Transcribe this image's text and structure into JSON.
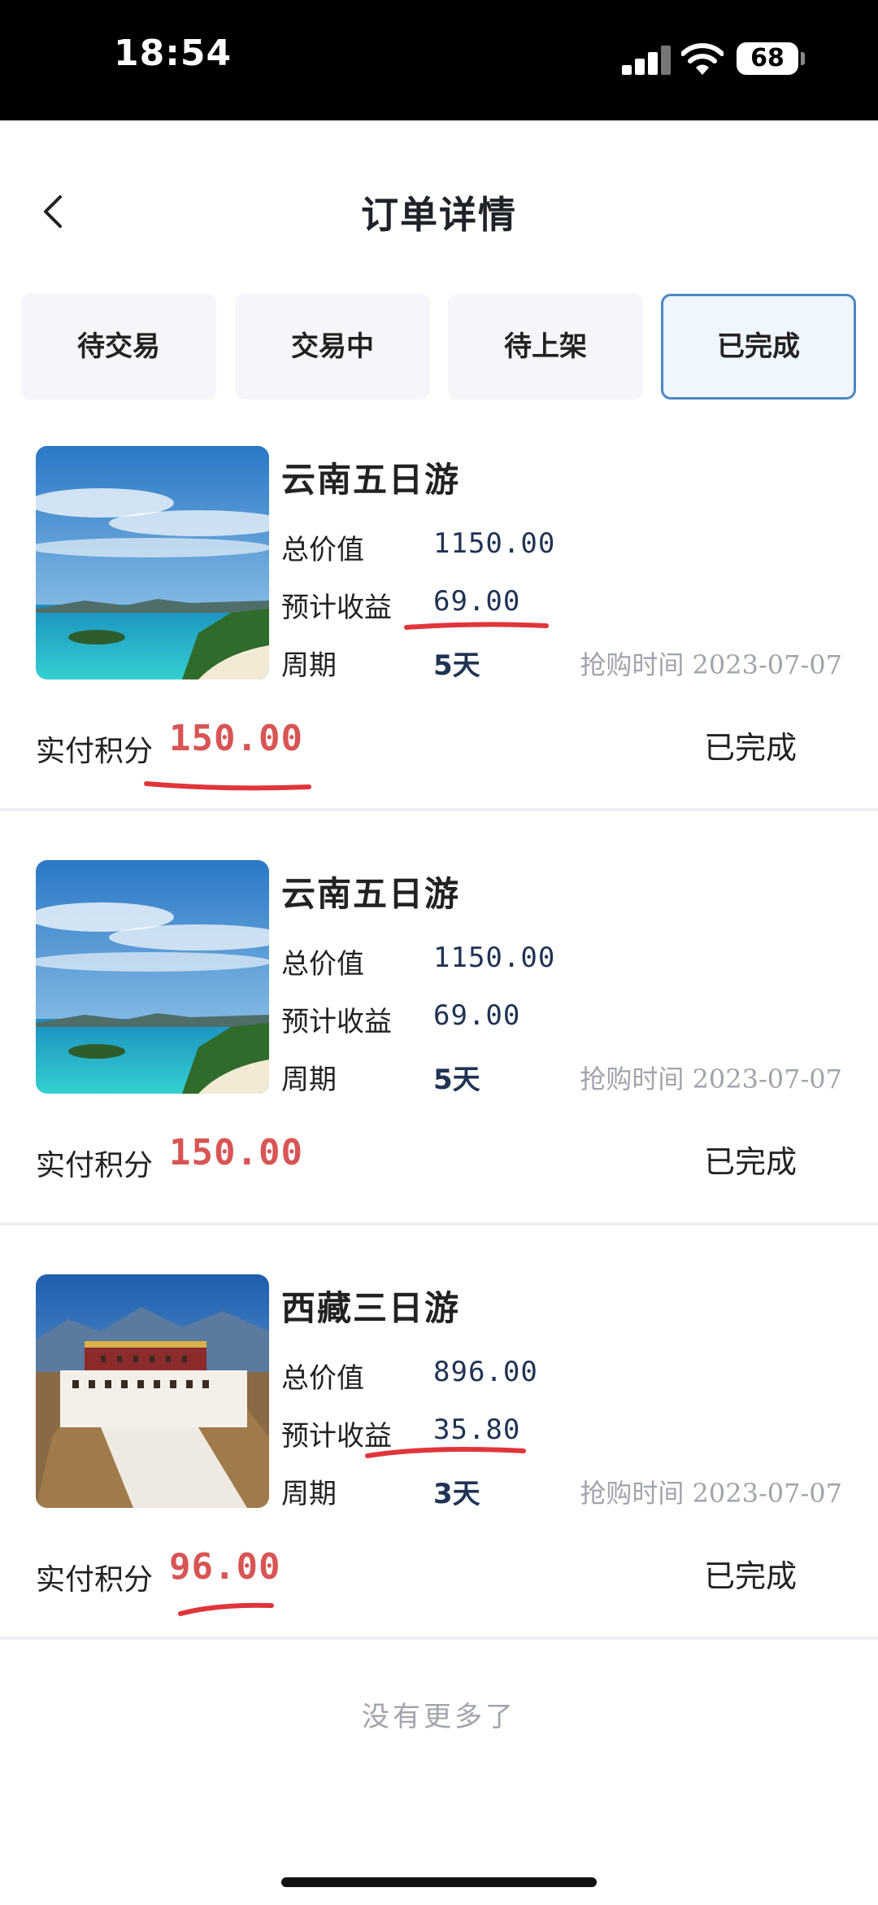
{
  "status_bar": {
    "time": "18:54",
    "battery": "68"
  },
  "header": {
    "title": "订单详情"
  },
  "tabs": [
    {
      "label": "待交易",
      "active": false
    },
    {
      "label": "交易中",
      "active": false
    },
    {
      "label": "待上架",
      "active": false
    },
    {
      "label": "已完成",
      "active": true
    }
  ],
  "labels": {
    "total_value": "总价值",
    "expected_income": "预计收益",
    "period": "周期",
    "purchase_time": "抢购时间",
    "paid_points": "实付积分"
  },
  "orders": [
    {
      "name": "云南五日游",
      "image": "tropical-beach",
      "total_value": "1150.00",
      "expected_income": "69.00",
      "period": "5天",
      "purchase_time": "2023-07-07",
      "paid_points": "150.00",
      "status": "已完成"
    },
    {
      "name": "云南五日游",
      "image": "tropical-beach",
      "total_value": "1150.00",
      "expected_income": "69.00",
      "period": "5天",
      "purchase_time": "2023-07-07",
      "paid_points": "150.00",
      "status": "已完成"
    },
    {
      "name": "西藏三日游",
      "image": "potala-palace",
      "total_value": "896.00",
      "expected_income": "35.80",
      "period": "3天",
      "purchase_time": "2023-07-07",
      "paid_points": "96.00",
      "status": "已完成"
    }
  ],
  "footer": {
    "no_more": "没有更多了"
  },
  "colors": {
    "accent_border": "#4d86c4",
    "price_red": "#d85555",
    "underline_red": "#e0353b"
  }
}
